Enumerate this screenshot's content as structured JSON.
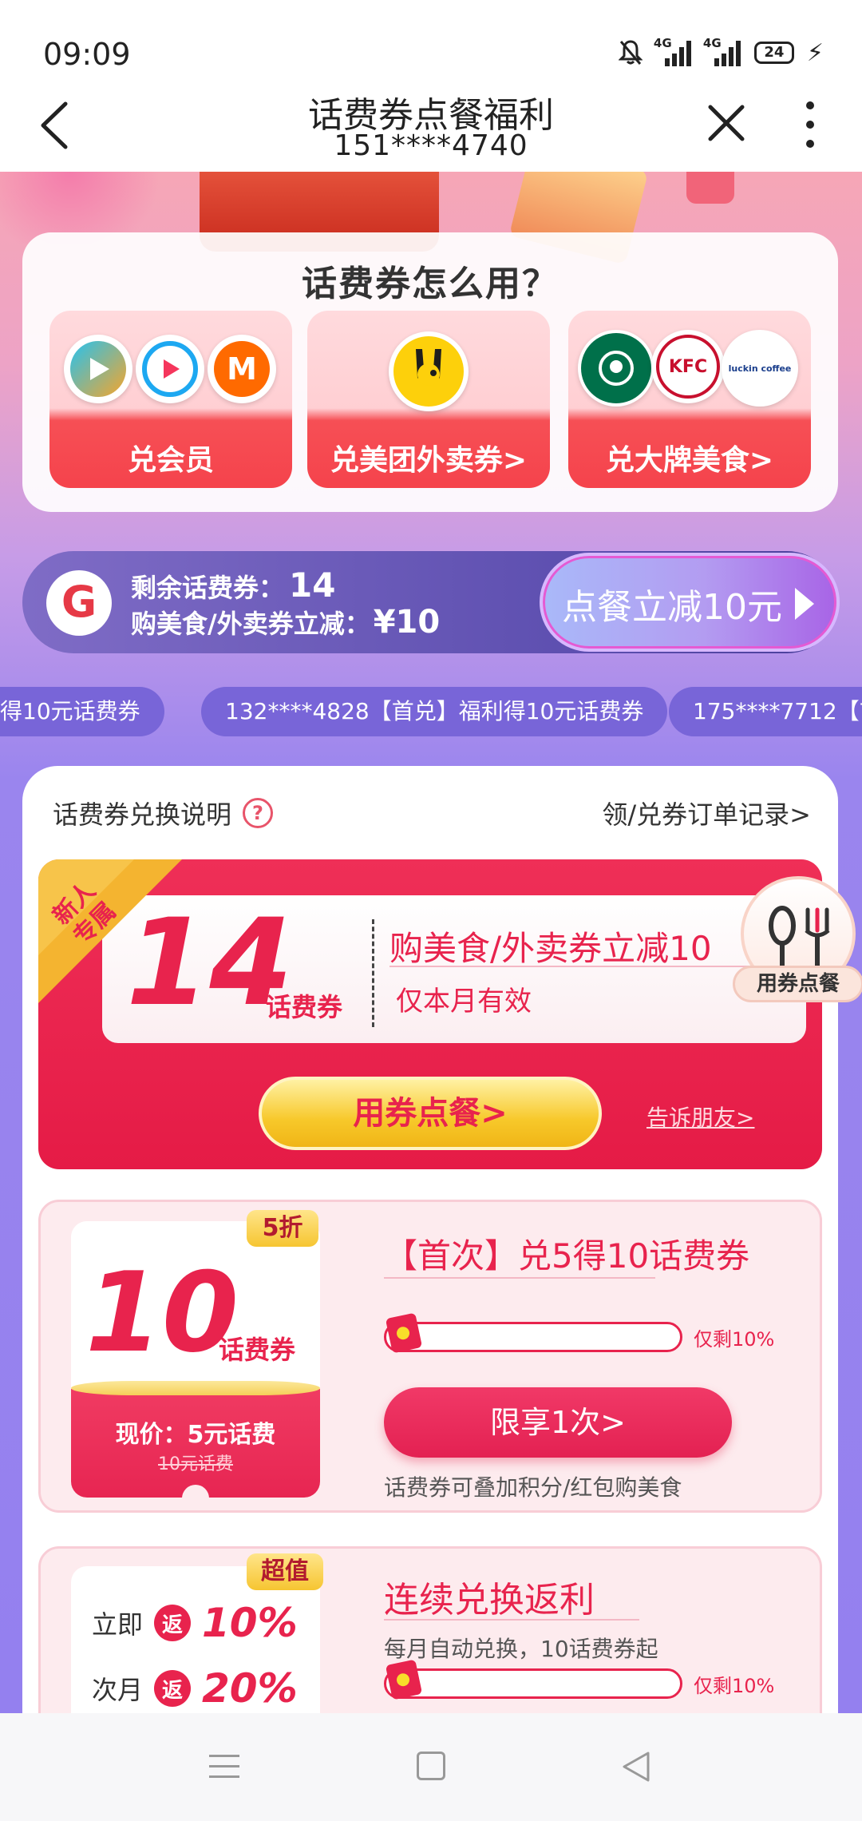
{
  "status_bar": {
    "time": "09:09",
    "net1": "4G",
    "net2": "4G",
    "battery": "24"
  },
  "title_bar": {
    "title": "话费券点餐福利",
    "subtitle": "151****4740"
  },
  "howto": {
    "title": "话费券怎么用？",
    "items": [
      {
        "label": "兑会员"
      },
      {
        "label": "兑美团外卖券>"
      },
      {
        "label": "兑大牌美食>"
      }
    ],
    "brand_kfc": "KFC",
    "brand_luckin": "luckin coffee"
  },
  "coupon_bar": {
    "logo": "G",
    "remain_label": "剩余话费券：",
    "remain_value": "14",
    "discount_label": "购美食/外卖券立减：",
    "discount_value": "¥10",
    "button": "点餐立减10元"
  },
  "ticker": [
    "得10元话费券",
    "132****4828【首兑】福利得10元话费券",
    "175****7712【首"
  ],
  "panel": {
    "explain": "话费券兑换说明",
    "qmark": "?",
    "records": "领/兑券订单记录>"
  },
  "new_card": {
    "ribbon": "新人\n专属",
    "ribbon_line1": "新人",
    "ribbon_line2": "专属",
    "amount": "14",
    "unit": "话费券",
    "desc": "购美食/外卖券立减10",
    "validity": "仅本月有效",
    "button": "用券点餐>",
    "share": "告诉朋友>",
    "badge": "用券点餐"
  },
  "exchange_card": {
    "discount_tag": "5折",
    "amount": "10",
    "unit": "话费券",
    "price": "现价：5元话费",
    "original": "10元话费",
    "title": "【首次】兑5得10话费券",
    "progress_fraction": 0.1,
    "remain": "仅剩10%",
    "button": "限享1次>",
    "note": "话费券可叠加积分/红包购美食"
  },
  "continuous_card": {
    "tag": "超值",
    "row1_prefix": "立即",
    "row1_badge": "返",
    "row1_value": "10%",
    "row2_prefix": "次月",
    "row2_badge": "返",
    "row2_value": "20%",
    "title": "连续兑换返利",
    "subtitle": "每月自动兑换，10话费券起",
    "progress_fraction": 0.1,
    "remain": "仅剩10%"
  },
  "colors": {
    "accent": "#e8234d",
    "bar": "#5c4eaf",
    "gold": "#f6c531",
    "page_bg": "#9480ef"
  }
}
